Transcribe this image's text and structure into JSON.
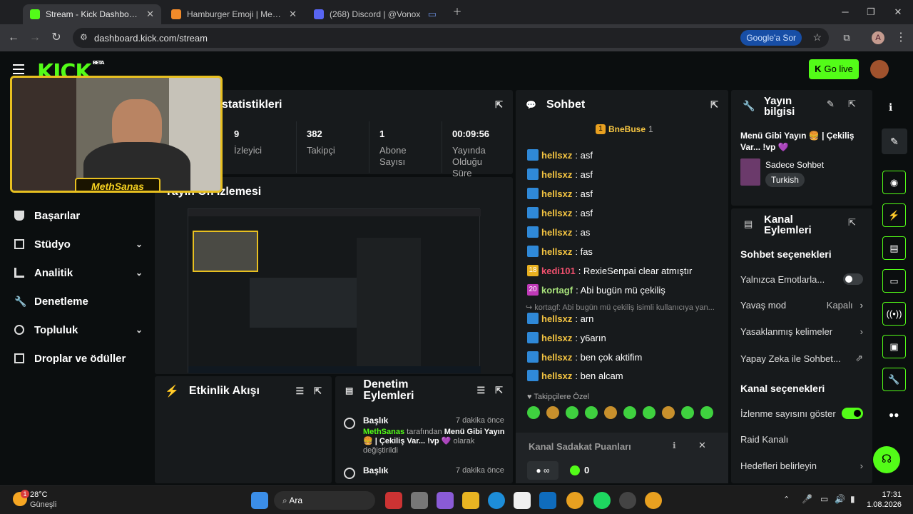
{
  "browser": {
    "tabs": [
      {
        "title": "Stream - Kick Dashboard"
      },
      {
        "title": "Hamburger Emoji | Meaning"
      },
      {
        "title": "(268) Discord | @Vonox"
      }
    ],
    "url": "dashboard.kick.com/stream",
    "google_btn": "Google'a Sor",
    "avatar_letter": "A"
  },
  "header": {
    "logo": "KICK",
    "beta": "BETA",
    "golive": "Go live"
  },
  "sidebar": {
    "items": [
      {
        "label": "Başarılar"
      },
      {
        "label": "Stüdyo"
      },
      {
        "label": "Analitik"
      },
      {
        "label": "Denetleme"
      },
      {
        "label": "Topluluk"
      },
      {
        "label": "Droplar ve ödüller"
      }
    ]
  },
  "webcam": {
    "name": "MethSanas"
  },
  "stats": {
    "title": "statistikleri",
    "items": [
      {
        "value": "9",
        "label": "İzleyici"
      },
      {
        "value": "382",
        "label": "Takipçi"
      },
      {
        "value": "1",
        "label": "Abone Sayısı"
      },
      {
        "value": "00:09:56",
        "label": "Yayında Olduğu Süre"
      }
    ]
  },
  "preview": {
    "title": "Yayın Ön İzlemesi"
  },
  "activity": {
    "title": "Etkinlik Akışı"
  },
  "mod": {
    "title": "Denetim Eylemleri",
    "entries": [
      {
        "title": "Başlık",
        "time": "7 dakika önce",
        "user": "MethSanas",
        "pre": "tarafından",
        "text": "Menü Gibi Yayın 🍔 | Çekiliş Var... !vp 💜",
        "post": "olarak değiştirildi"
      },
      {
        "title": "Başlık",
        "time": "7 dakika önce"
      }
    ]
  },
  "chat": {
    "title": "Sohbet",
    "pinned_user": "BneBuse",
    "pinned_count": "1",
    "messages": [
      {
        "user": "hellsxz",
        "text": ": asf"
      },
      {
        "user": "hellsxz",
        "text": ": asf"
      },
      {
        "user": "hellsxz",
        "text": ": asf"
      },
      {
        "user": "hellsxz",
        "text": ": asf"
      },
      {
        "user": "hellsxz",
        "text": ": as"
      },
      {
        "user": "hellsxz",
        "text": ": fas"
      },
      {
        "user": "kedi101",
        "text": ": RexieSenpai clear atmıştır",
        "badge": "18"
      },
      {
        "user": "kortagf",
        "text": ": Abi bugün mü çekiliş",
        "badge": "20"
      }
    ],
    "reply": "kortagf: Abi bugün mü çekiliş isimli kullanıcıya yan...",
    "messages2": [
      {
        "user": "hellsxz",
        "text": ": arn"
      },
      {
        "user": "hellsxz",
        "text": ": y6arın"
      },
      {
        "user": "hellsxz",
        "text": ": ben çok aktifim"
      },
      {
        "user": "hellsxz",
        "text": ": ben alcam"
      }
    ],
    "followers_only": "Takipçilere Özel",
    "points_title": "Kanal Sadakat Puanları",
    "points_value": "0"
  },
  "info": {
    "title": "Yayın bilgisi",
    "stream_title": "Menü Gibi Yayın 🍔 | Çekiliş Var... !vp 💜",
    "category": "Sadece Sohbet",
    "language": "Turkish"
  },
  "channel": {
    "title": "Kanal Eylemleri",
    "chat_options": "Sohbet seçenekleri",
    "emotes": "Yalnızca Emotlarla...",
    "slow": "Yavaş mod",
    "slow_value": "Kapalı",
    "banned": "Yasaklanmış kelimeler",
    "ai": "Yapay Zeka ile Sohbet...",
    "channel_options": "Kanal seçenekleri",
    "viewcount": "İzlenme sayısını göster",
    "raid": "Raid Kanalı",
    "goals": "Hedefleri belirleyin"
  },
  "taskbar": {
    "temp": "28°C",
    "weather": "Güneşli",
    "search": "Ara",
    "time": "17:31",
    "date": "1.08.2026",
    "badge": "1"
  },
  "colors": {
    "accent": "#53fc18",
    "panel": "#171a1c"
  }
}
